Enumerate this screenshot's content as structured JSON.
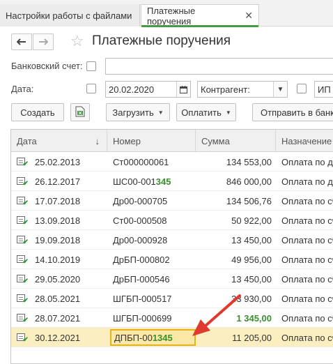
{
  "tabs": [
    {
      "label": "Настройки работы с файлами",
      "active": false
    },
    {
      "label": "Платежные поручения",
      "active": true,
      "close": "✕"
    }
  ],
  "header": {
    "title": "Платежные поручения",
    "back": "🡐",
    "forward": "🡒",
    "star": "☆"
  },
  "filters": {
    "bank_account_label": "Банковский счет:",
    "date_label": "Дата:",
    "date_value": "20.02.2020",
    "counterparty_value": "Контрагент:",
    "ip_value": "ИП"
  },
  "toolbar": {
    "create": "Создать",
    "load": "Загрузить",
    "pay": "Оплатить",
    "send": "Отправить в банк"
  },
  "table": {
    "columns": [
      "Дата",
      "Номер",
      "Сумма",
      "Назначение"
    ],
    "rows": [
      {
        "date": "25.02.2013",
        "num_a": "Ст000000061",
        "num_b": "",
        "sum_a": "134 553,00",
        "sum_b": "",
        "purpose": "Оплата  по д"
      },
      {
        "date": "26.12.2017",
        "num_a": "ШС00-001",
        "num_b": "345",
        "sum_a": "846 000,00",
        "sum_b": "",
        "purpose": "Оплата  по д"
      },
      {
        "date": "17.07.2018",
        "num_a": "Др00-000705",
        "num_b": "",
        "sum_a": "134 506,76",
        "sum_b": "",
        "purpose": "Оплата  по сч"
      },
      {
        "date": "13.09.2018",
        "num_a": "Ст00-000508",
        "num_b": "",
        "sum_a": "50 922,00",
        "sum_b": "",
        "purpose": "Оплата  по сч"
      },
      {
        "date": "19.09.2018",
        "num_a": "Др00-000928",
        "num_b": "",
        "sum_a": "13 450,00",
        "sum_b": "",
        "purpose": "Оплата  по сч"
      },
      {
        "date": "14.10.2019",
        "num_a": "ДрБП-000802",
        "num_b": "",
        "sum_a": "49 956,00",
        "sum_b": "",
        "purpose": "Оплата  по сч"
      },
      {
        "date": "29.05.2020",
        "num_a": "ДрБП-000546",
        "num_b": "",
        "sum_a": "13 450,00",
        "sum_b": "",
        "purpose": "Оплата  по сч"
      },
      {
        "date": "28.05.2021",
        "num_a": "ШГБП-000517",
        "num_b": "",
        "sum_a": "33 930,00",
        "sum_b": "",
        "purpose": "Оплата  по сч"
      },
      {
        "date": "28.07.2021",
        "num_a": "ШГБП-000699",
        "num_b": "",
        "sum_a": "",
        "sum_b": "1 345,00",
        "purpose": "Оплата  по сч"
      },
      {
        "date": "30.12.2021",
        "num_a": "ДПБП-00",
        "num_b": "1345",
        "sum_a": "11 205,00",
        "sum_b": "",
        "purpose": "Оплата  по сч"
      }
    ]
  },
  "colors": {
    "accent_green": "#4a9a45",
    "highlight": "#fbe9a5",
    "arrow": "#e03a2e"
  }
}
